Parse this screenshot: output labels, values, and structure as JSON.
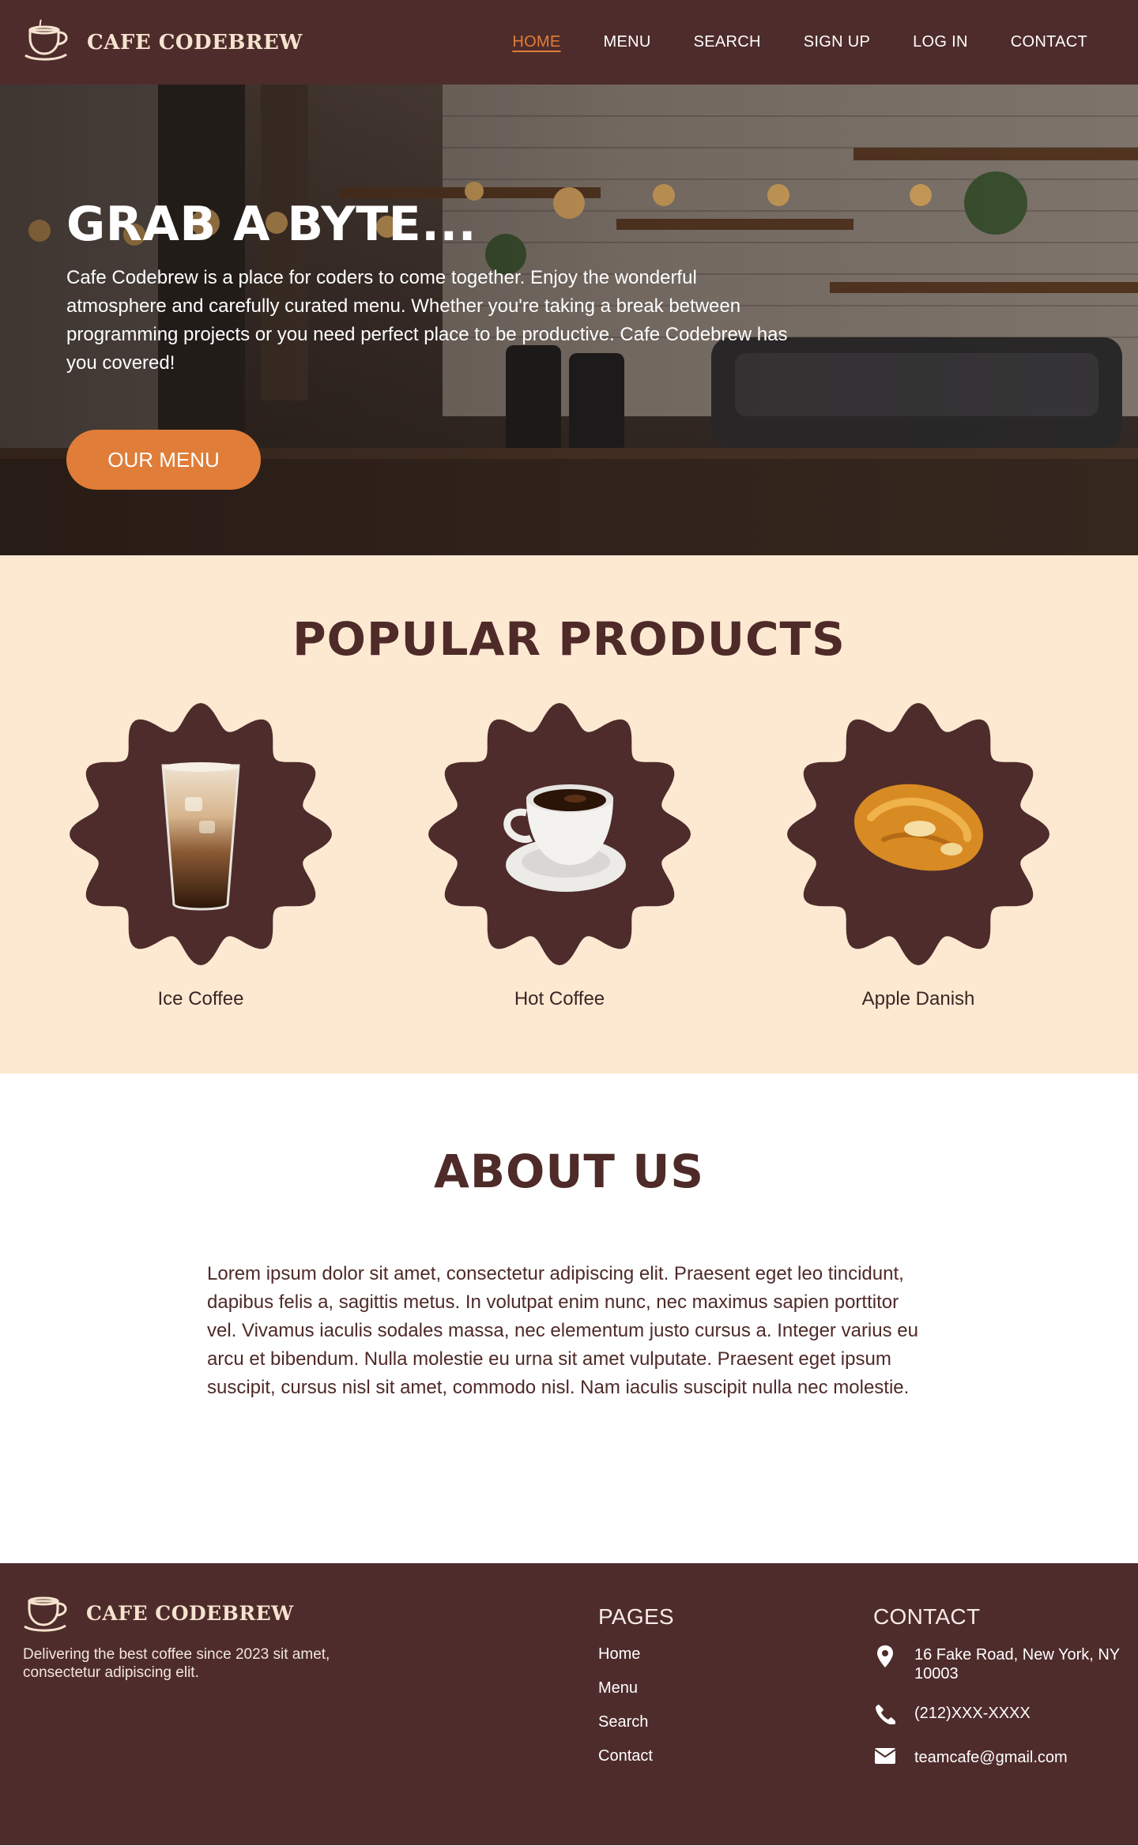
{
  "nav": {
    "brand": "CAFE CODEBREW",
    "logo_icon": "coffee-cup-icon",
    "links": [
      "HOME",
      "MENU",
      "SEARCH",
      "SIGN UP",
      "LOG IN",
      "CONTACT"
    ],
    "active": "HOME",
    "active_color": "#e07d38"
  },
  "hero": {
    "title": "GRAB A BYTE...",
    "text": "Cafe Codebrew is a place for coders to come together. Enjoy the wonderful atmosphere and carefully curated menu. Whether you're taking a break between programming projects or you need perfect place to be productive. Cafe Codebrew has you covered!",
    "button": "OUR MENU",
    "button_color": "#e07d38"
  },
  "popular": {
    "title": "POPULAR PRODUCTS",
    "products": [
      {
        "name": "Ice Coffee",
        "icon": "iced-coffee-glass-icon"
      },
      {
        "name": "Hot Coffee",
        "icon": "hot-coffee-cup-icon"
      },
      {
        "name": "Apple Danish",
        "icon": "apple-danish-pastry-icon"
      }
    ],
    "background": "#fde9d2",
    "badge_color": "#4e2c2b"
  },
  "about": {
    "title": "ABOUT US",
    "text": "Lorem ipsum dolor sit amet, consectetur adipiscing elit. Praesent eget leo tincidunt, dapibus felis a, sagittis metus. In volutpat enim nunc, nec maximus sapien porttitor vel. Vivamus iaculis sodales massa, nec elementum justo cursus a. Integer varius eu arcu et bibendum. Nulla molestie eu urna sit amet vulputate. Praesent eget ipsum suscipit, cursus nisl sit amet, commodo nisl. Nam iaculis suscipit nulla nec molestie."
  },
  "footer": {
    "brand": "CAFE CODEBREW",
    "tagline": "Delivering the best coffee since 2023 sit amet, consectetur adipiscing elit.",
    "pages_title": "PAGES",
    "pages": [
      "Home",
      "Menu",
      "Search",
      "Contact"
    ],
    "contact_title": "CONTACT",
    "contact": [
      {
        "icon": "location-pin-icon",
        "text": "16 Fake Road, New York, NY 10003"
      },
      {
        "icon": "phone-icon",
        "text": "(212)XXX-XXXX"
      },
      {
        "icon": "envelope-icon",
        "text": "teamcafe@gmail.com"
      }
    ],
    "background": "#4e2c2b"
  }
}
